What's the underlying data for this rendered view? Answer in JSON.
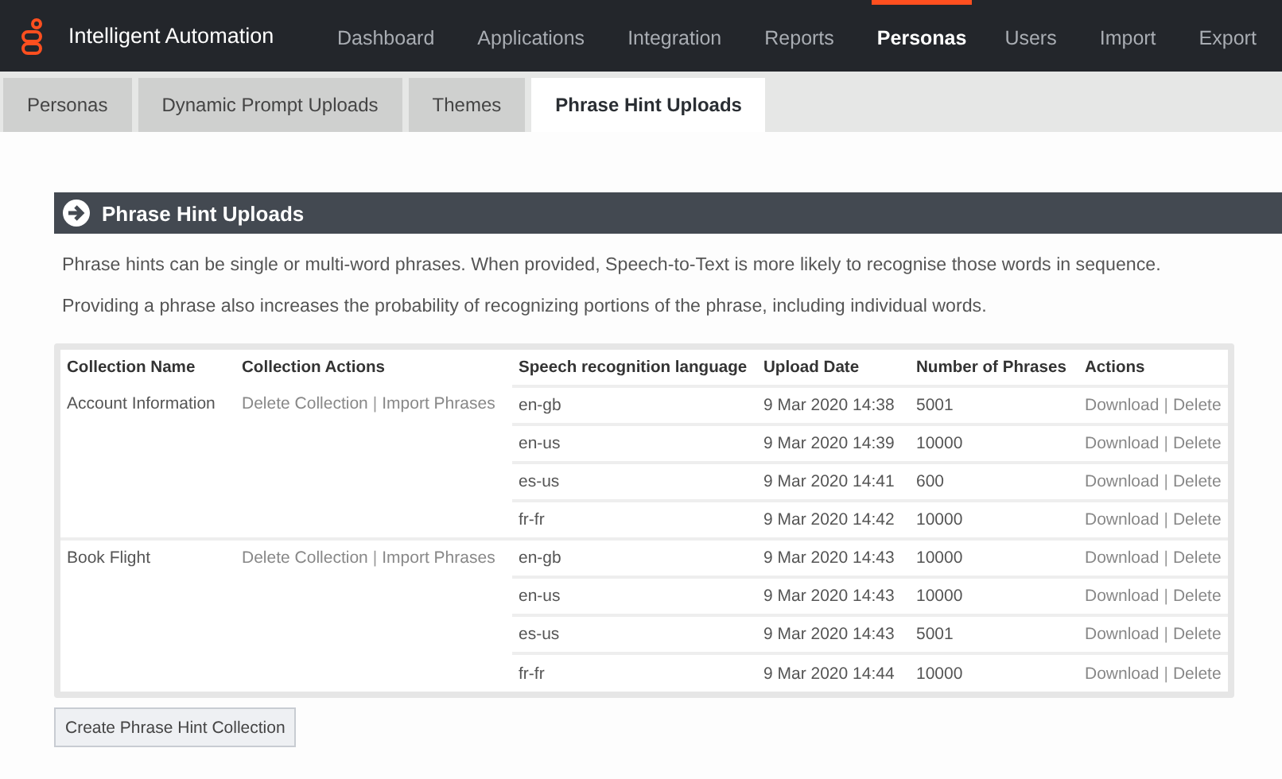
{
  "app": {
    "title": "Intelligent Automation"
  },
  "nav": [
    {
      "label": "Dashboard",
      "selected": false
    },
    {
      "label": "Applications",
      "selected": false
    },
    {
      "label": "Integration",
      "selected": false
    },
    {
      "label": "Reports",
      "selected": false
    },
    {
      "label": "Personas",
      "selected": true
    },
    {
      "label": "Users",
      "selected": false
    },
    {
      "label": "Import",
      "selected": false
    },
    {
      "label": "Export",
      "selected": false
    }
  ],
  "tabs": [
    {
      "label": "Personas",
      "selected": false
    },
    {
      "label": "Dynamic Prompt Uploads",
      "selected": false
    },
    {
      "label": "Themes",
      "selected": false
    },
    {
      "label": "Phrase Hint Uploads",
      "selected": true
    }
  ],
  "panel": {
    "title": "Phrase Hint Uploads",
    "paragraphs": [
      "Phrase hints can be single or multi-word phrases. When provided, Speech-to-Text is more likely to recognise those words in sequence.",
      "Providing a phrase also increases the probability of recognizing portions of the phrase, including individual words."
    ]
  },
  "table": {
    "columns": [
      "Collection Name",
      "Collection Actions",
      "Speech recognition language",
      "Upload Date",
      "Number of Phrases",
      "Actions"
    ],
    "collections": [
      {
        "name": "Account Information",
        "actions": [
          "Delete Collection",
          "|",
          "Import Phrases"
        ],
        "uploads": [
          {
            "language": "en-gb",
            "date": "9 Mar 2020 14:38",
            "count": "5001",
            "actions": [
              "Download",
              "|",
              "Delete"
            ]
          },
          {
            "language": "en-us",
            "date": "9 Mar 2020 14:39",
            "count": "10000",
            "actions": [
              "Download",
              "|",
              "Delete"
            ]
          },
          {
            "language": "es-us",
            "date": "9 Mar 2020 14:41",
            "count": "600",
            "actions": [
              "Download",
              "|",
              "Delete"
            ]
          },
          {
            "language": "fr-fr",
            "date": "9 Mar 2020 14:42",
            "count": "10000",
            "actions": [
              "Download",
              "|",
              "Delete"
            ]
          }
        ]
      },
      {
        "name": "Book Flight",
        "actions": [
          "Delete Collection",
          "|",
          "Import Phrases"
        ],
        "uploads": [
          {
            "language": "en-gb",
            "date": "9 Mar 2020 14:43",
            "count": "10000",
            "actions": [
              "Download",
              "|",
              "Delete"
            ]
          },
          {
            "language": "en-us",
            "date": "9 Mar 2020 14:43",
            "count": "10000",
            "actions": [
              "Download",
              "|",
              "Delete"
            ]
          },
          {
            "language": "es-us",
            "date": "9 Mar 2020 14:43",
            "count": "5001",
            "actions": [
              "Download",
              "|",
              "Delete"
            ]
          },
          {
            "language": "fr-fr",
            "date": "9 Mar 2020 14:44",
            "count": "10000",
            "actions": [
              "Download",
              "|",
              "Delete"
            ]
          }
        ]
      }
    ]
  },
  "create_button": "Create Phrase Hint Collection"
}
